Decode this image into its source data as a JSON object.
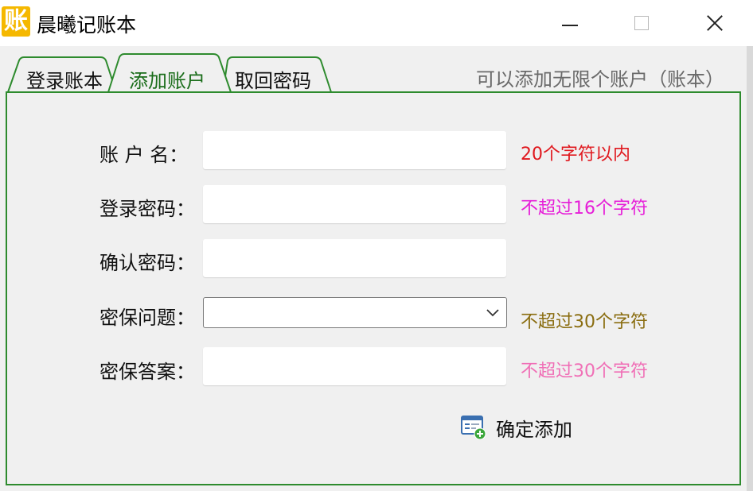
{
  "window": {
    "app_icon_glyph": "账",
    "title": "晨曦记账本"
  },
  "tabs": [
    {
      "label": "登录账本",
      "active": false
    },
    {
      "label": "添加账户",
      "active": true
    },
    {
      "label": "取回密码",
      "active": false
    }
  ],
  "tab_hint": "可以添加无限个账户（账本）",
  "form": {
    "account_name": {
      "label": "账 户 名：",
      "value": "",
      "hint": "20个字符以内",
      "hint_color": "#e0181e"
    },
    "login_password": {
      "label": "登录密码：",
      "value": "",
      "hint": "不超过16个字符",
      "hint_color": "#e61ed8"
    },
    "confirm_password": {
      "label": "确认密码：",
      "value": ""
    },
    "security_question": {
      "label": "密保问题：",
      "selected": "",
      "hint": "不超过30个字符",
      "hint_color": "#8a6d10"
    },
    "security_answer": {
      "label": "密保答案：",
      "value": "",
      "hint": "不超过30个字符",
      "hint_color": "#f06fb6"
    }
  },
  "confirm_button": {
    "label": "确定添加",
    "icon": "form-add-icon"
  },
  "colors": {
    "app_icon": "#f5b800",
    "tab_border": "#2e8b2e",
    "active_tab_text": "#1a6d1a"
  }
}
